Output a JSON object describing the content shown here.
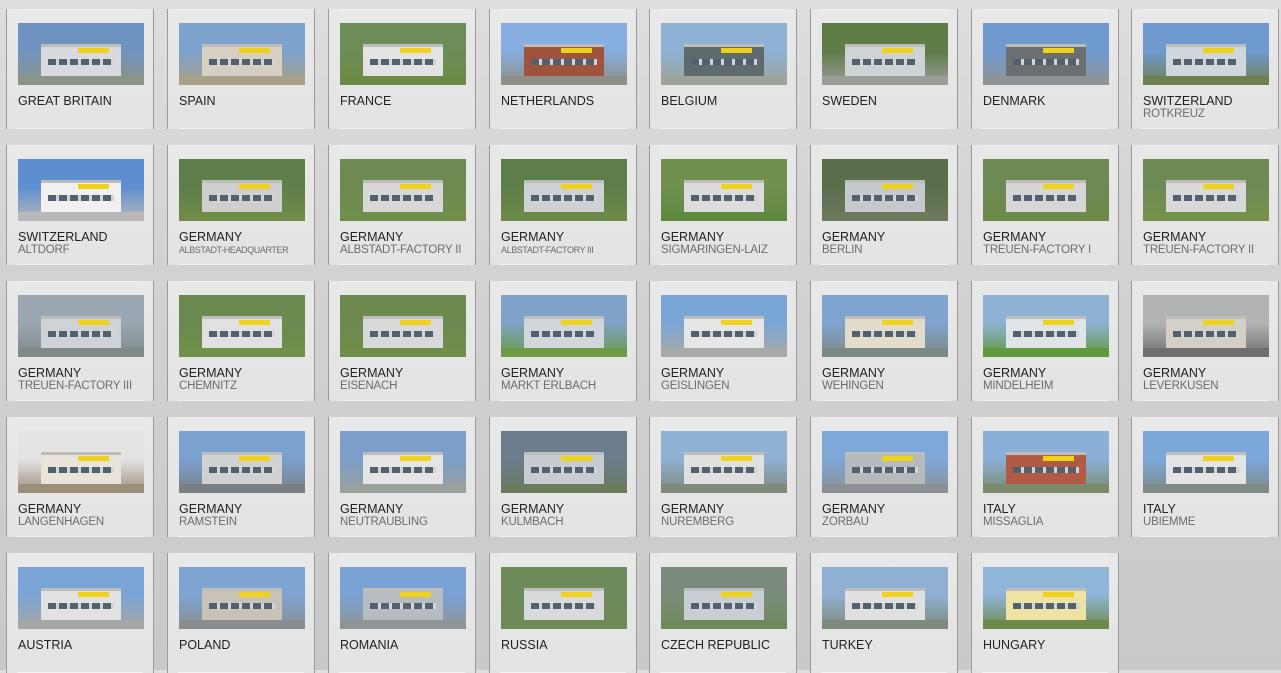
{
  "locations": [
    {
      "country": "GREAT BRITAIN",
      "city": "",
      "photo": {
        "sky": "#6f93c0",
        "wall": "#d8dadd",
        "accent": "#f1d01d",
        "ground": "#8c9488"
      }
    },
    {
      "country": "SPAIN",
      "city": "",
      "photo": {
        "sky": "#7da2cc",
        "wall": "#d6cfc2",
        "accent": "#f0cf18",
        "ground": "#a9a08a"
      }
    },
    {
      "country": "FRANCE",
      "city": "",
      "photo": {
        "sky": "#6c8c58",
        "wall": "#e3e3e3",
        "accent": "#f0d21d",
        "ground": "#6b8b45"
      }
    },
    {
      "country": "NETHERLANDS",
      "city": "",
      "photo": {
        "sky": "#86aee0",
        "wall": "#a0533c",
        "accent": "#f0d21d",
        "ground": "#8f8f88"
      }
    },
    {
      "country": "BELGIUM",
      "city": "",
      "photo": {
        "sky": "#8db2d5",
        "wall": "#5f6a6d",
        "accent": "#f1d01d",
        "ground": "#9da29a"
      }
    },
    {
      "country": "SWEDEN",
      "city": "",
      "photo": {
        "sky": "#5d7c46",
        "wall": "#d0d3d5",
        "accent": "#f0d21d",
        "ground": "#9b9d98"
      }
    },
    {
      "country": "DENMARK",
      "city": "",
      "photo": {
        "sky": "#6f9ace",
        "wall": "#6b6f72",
        "accent": "#f0d21d",
        "ground": "#8f9398"
      }
    },
    {
      "country": "SWITZERLAND",
      "city": "ROTKREUZ",
      "photo": {
        "sky": "#6f9ad0",
        "wall": "#cfd6dc",
        "accent": "#f1d01d",
        "ground": "#6f8050"
      }
    },
    {
      "country": "SWITZERLAND",
      "city": "ALTDORF",
      "photo": {
        "sky": "#5d8fd0",
        "wall": "#f0f0f0",
        "accent": "#f0d21d",
        "ground": "#b8b8b8"
      }
    },
    {
      "country": "GERMANY",
      "city": "ALBSTADT-HEADQUARTER",
      "photo": {
        "sky": "#5f7f4a",
        "wall": "#cfcfcf",
        "accent": "#f0d21d",
        "ground": "#6e8b48"
      }
    },
    {
      "country": "GERMANY",
      "city": "ALBSTADT-FACTORY II",
      "photo": {
        "sky": "#6d8a52",
        "wall": "#d8d8d8",
        "accent": "#f0d21d",
        "ground": "#6f8f4a"
      }
    },
    {
      "country": "GERMANY",
      "city": "ALBSTADT-FACTORY III",
      "photo": {
        "sky": "#5e7e49",
        "wall": "#cfd2d4",
        "accent": "#f0d21d",
        "ground": "#6c8a47"
      }
    },
    {
      "country": "GERMANY",
      "city": "SIGMARINGEN-LAIZ",
      "photo": {
        "sky": "#6f8f4f",
        "wall": "#dcdcdc",
        "accent": "#f0d21d",
        "ground": "#5f8a3e"
      }
    },
    {
      "country": "GERMANY",
      "city": "BERLIN",
      "photo": {
        "sky": "#5a6e4c",
        "wall": "#c6c9cc",
        "accent": "#f0d21d",
        "ground": "#6a7a5a"
      }
    },
    {
      "country": "GERMANY",
      "city": "TREUEN-FACTORY I",
      "photo": {
        "sky": "#6e8a54",
        "wall": "#d6d6d6",
        "accent": "#f0d21d",
        "ground": "#6c8a48"
      }
    },
    {
      "country": "GERMANY",
      "city": "TREUEN-FACTORY II",
      "photo": {
        "sky": "#6e8a54",
        "wall": "#d9d9d9",
        "accent": "#f0d21d",
        "ground": "#75924c"
      }
    },
    {
      "country": "GERMANY",
      "city": "TREUEN-FACTORY III",
      "photo": {
        "sky": "#9aa7b3",
        "wall": "#cfd3d6",
        "accent": "#f0d21d",
        "ground": "#7f8a86"
      }
    },
    {
      "country": "GERMANY",
      "city": "CHEMNITZ",
      "photo": {
        "sky": "#6a8a4f",
        "wall": "#e1e1e1",
        "accent": "#f0d21d",
        "ground": "#6f914a"
      }
    },
    {
      "country": "GERMANY",
      "city": "EISENACH",
      "photo": {
        "sky": "#6c8a50",
        "wall": "#d9d9d9",
        "accent": "#f0d21d",
        "ground": "#6f8e49"
      }
    },
    {
      "country": "GERMANY",
      "city": "MARKT ERLBACH",
      "photo": {
        "sky": "#7ea2c8",
        "wall": "#cfd7da",
        "accent": "#f0d21d",
        "ground": "#6c9b43"
      }
    },
    {
      "country": "GERMANY",
      "city": "GEISLINGEN",
      "photo": {
        "sky": "#7aa6d6",
        "wall": "#e6e6e6",
        "accent": "#f0d21d",
        "ground": "#a9aaa7"
      }
    },
    {
      "country": "GERMANY",
      "city": "WEHINGEN",
      "photo": {
        "sky": "#7fa4cf",
        "wall": "#e3dccb",
        "accent": "#f0d21d",
        "ground": "#7c8a86"
      }
    },
    {
      "country": "GERMANY",
      "city": "MINDELHEIM",
      "photo": {
        "sky": "#8fb1d3",
        "wall": "#dfe4e6",
        "accent": "#f0d21d",
        "ground": "#5f9a3d"
      }
    },
    {
      "country": "GERMANY",
      "city": "LEVERKUSEN",
      "photo": {
        "sky": "#b1b3b4",
        "wall": "#d4d0c7",
        "accent": "#f0d21d",
        "ground": "#6f6f6f"
      }
    },
    {
      "country": "GERMANY",
      "city": "LANGENHAGEN",
      "photo": {
        "sky": "#e4e4e4",
        "wall": "#e8e4da",
        "accent": "#f0d21d",
        "ground": "#9c8f7a"
      }
    },
    {
      "country": "GERMANY",
      "city": "RAMSTEIN",
      "photo": {
        "sky": "#7ba1cf",
        "wall": "#cfd1d2",
        "accent": "#f0d21d",
        "ground": "#7a7f83"
      }
    },
    {
      "country": "GERMANY",
      "city": "NEUTRAUBLING",
      "photo": {
        "sky": "#7c9ec8",
        "wall": "#e5e5e5",
        "accent": "#f0d21d",
        "ground": "#9aa09a"
      }
    },
    {
      "country": "GERMANY",
      "city": "KULMBACH",
      "photo": {
        "sky": "#6b7c8c",
        "wall": "#c7ccd0",
        "accent": "#f0d21d",
        "ground": "#6a7c5c"
      }
    },
    {
      "country": "GERMANY",
      "city": "NUREMBERG",
      "photo": {
        "sky": "#8fb1d3",
        "wall": "#e0e0e0",
        "accent": "#f0d21d",
        "ground": "#7f8a7a"
      }
    },
    {
      "country": "GERMANY",
      "city": "ZORBAU",
      "photo": {
        "sky": "#7ea8d8",
        "wall": "#b7babd",
        "accent": "#f0d21d",
        "ground": "#8c9095"
      }
    },
    {
      "country": "ITALY",
      "city": "MISSAGLIA",
      "photo": {
        "sky": "#8ab0d8",
        "wall": "#b15a45",
        "accent": "#f0d21d",
        "ground": "#7a8a6a"
      }
    },
    {
      "country": "ITALY",
      "city": "UBIEMME",
      "photo": {
        "sky": "#7ba7d9",
        "wall": "#e4e4e4",
        "accent": "#f0d21d",
        "ground": "#7e8a86"
      }
    },
    {
      "country": "AUSTRIA",
      "city": "",
      "photo": {
        "sky": "#7aa4d6",
        "wall": "#e2e2e2",
        "accent": "#f0d21d",
        "ground": "#a4a7a6"
      }
    },
    {
      "country": "POLAND",
      "city": "",
      "photo": {
        "sky": "#7ea5d2",
        "wall": "#c9c2b7",
        "accent": "#f0d21d",
        "ground": "#8a8d8f"
      }
    },
    {
      "country": "ROMANIA",
      "city": "",
      "photo": {
        "sky": "#7aa2d4",
        "wall": "#b7bcc1",
        "accent": "#f0d21d",
        "ground": "#8f9497"
      }
    },
    {
      "country": "RUSSIA",
      "city": "",
      "photo": {
        "sky": "#6c8a5a",
        "wall": "#d8dadc",
        "accent": "#f0d21d",
        "ground": "#6e8b55"
      }
    },
    {
      "country": "CZECH REPUBLIC",
      "city": "",
      "photo": {
        "sky": "#7c8c7c",
        "wall": "#c9ced2",
        "accent": "#f0d21d",
        "ground": "#6f8a5a"
      }
    },
    {
      "country": "TURKEY",
      "city": "",
      "photo": {
        "sky": "#8fb0d2",
        "wall": "#e0e0e0",
        "accent": "#f0d21d",
        "ground": "#7d8a7c"
      }
    },
    {
      "country": "HUNGARY",
      "city": "",
      "photo": {
        "sky": "#8fb5d8",
        "wall": "#efe3a3",
        "accent": "#f0d21d",
        "ground": "#6e8a4a"
      }
    }
  ]
}
